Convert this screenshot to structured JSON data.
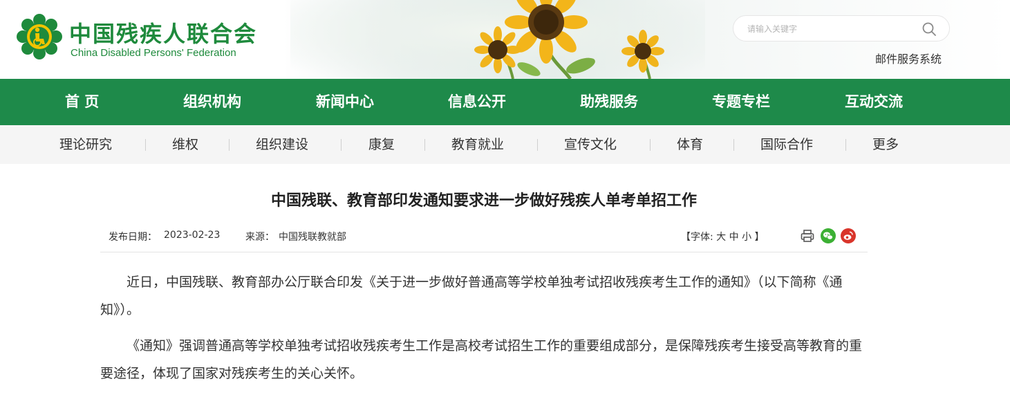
{
  "header": {
    "logo_cn": "中国残疾人联合会",
    "logo_en": "China Disabled Persons' Federation",
    "search": {
      "placeholder": "请输入关键字"
    },
    "mail_link": "邮件服务系统"
  },
  "main_nav": {
    "items": [
      {
        "label": "首 页"
      },
      {
        "label": "组织机构"
      },
      {
        "label": "新闻中心"
      },
      {
        "label": "信息公开"
      },
      {
        "label": "助残服务"
      },
      {
        "label": "专题专栏"
      },
      {
        "label": "互动交流"
      }
    ]
  },
  "sub_nav": {
    "items": [
      {
        "label": "理论研究"
      },
      {
        "label": "维权"
      },
      {
        "label": "组织建设"
      },
      {
        "label": "康复"
      },
      {
        "label": "教育就业"
      },
      {
        "label": "宣传文化"
      },
      {
        "label": "体育"
      },
      {
        "label": "国际合作"
      },
      {
        "label": "更多"
      }
    ]
  },
  "article": {
    "title": "中国残联、教育部印发通知要求进一步做好残疾人单考单招工作",
    "date_label": "发布日期：",
    "date": "2023-02-23",
    "source_label": "来源：",
    "source": "中国残联教就部",
    "font_open": "【字体: ",
    "font_large": "大",
    "font_medium": "中",
    "font_small": "小",
    "font_close": " 】",
    "paragraphs": [
      "近日，中国残联、教育部办公厅联合印发《关于进一步做好普通高等学校单独考试招收残疾考生工作的通知》（以下简称《通知》）。",
      "《通知》强调普通高等学校单独考试招收残疾考生工作是高校考试招生工作的重要组成部分，是保障残疾考生接受高等教育的重要途径，体现了国家对残疾考生的关心关怀。"
    ]
  },
  "colors": {
    "brand_green": "#1e8a4a",
    "logo_green": "#1e8a3c",
    "logo_yellow": "#f2c400",
    "wechat_green": "#3cb034",
    "weibo_red": "#d9352b"
  },
  "icons": {
    "logo": "cdpf-emblem-icon",
    "search": "search-icon",
    "print": "print-icon",
    "wechat": "wechat-icon",
    "weibo": "weibo-icon",
    "banner": "sunflower-banner-image"
  }
}
